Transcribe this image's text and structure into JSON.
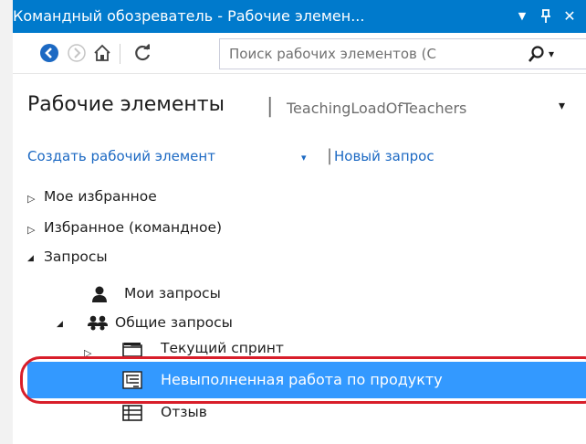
{
  "window": {
    "title": "Командный обозреватель - Рабочие элемен...",
    "dropdown_glyph": "▼",
    "pin_glyph": "ꟸ",
    "close_glyph": "✕"
  },
  "toolbar": {
    "buttons": [
      "back-icon",
      "forward-icon",
      "home-icon",
      "refresh-icon"
    ],
    "search_placeholder": "Поиск рабочих элементов (С",
    "search_icon": "search-icon",
    "search_dropdown_glyph": "▾"
  },
  "header": {
    "title": "Рабочие элементы",
    "separator": "|",
    "project": "TeachingLoadOfTeachers",
    "dropdown_glyph": "▾"
  },
  "links": {
    "new_work_item": "Создать рабочий элемент",
    "caret": "▾",
    "separator": "|",
    "new_query": "Новый запрос"
  },
  "tree": {
    "my_favorites": {
      "arrow": "▷",
      "label": "Мое избранное"
    },
    "team_favorites": {
      "arrow": "▷",
      "label": "Избранное (командное)"
    },
    "queries": {
      "arrow": "◢",
      "label": "Запросы"
    },
    "my_queries": {
      "icon": "user-icon",
      "label": "Мои запросы"
    },
    "shared_queries": {
      "arrow": "◢",
      "icon": "team-icon",
      "label": "Общие запросы"
    },
    "current_sprint": {
      "arrow": "▷",
      "icon": "folder-icon",
      "label": "Текущий спринт"
    },
    "product_backlog": {
      "icon": "tree-query-icon",
      "label": "Невыполненная работа по продукту",
      "selected": true
    },
    "feedback": {
      "icon": "flat-query-icon",
      "label": "Отзыв"
    }
  },
  "colors": {
    "accent": "#007acc",
    "selection": "#3399ff",
    "link": "#1c69c3",
    "highlight_ring": "#d81e2a"
  }
}
